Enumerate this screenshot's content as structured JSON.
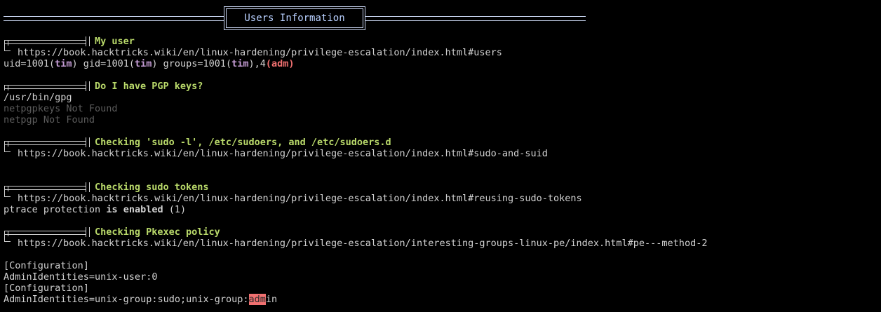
{
  "banner": {
    "title": "Users Information"
  },
  "sections": {
    "my_user": {
      "title": "My user",
      "url": "https://book.hacktricks.wiki/en/linux-hardening/privilege-escalation/index.html#users",
      "output": {
        "p1": "uid=1001(",
        "u1": "tim",
        "p2": ") gid=1001(",
        "u2": "tim",
        "p3": ") groups=1001(",
        "u3": "tim",
        "p4": "),4",
        "adm": "(adm)"
      }
    },
    "pgp": {
      "title": "Do I have PGP keys?",
      "lines": [
        "/usr/bin/gpg",
        "netpgpkeys Not Found",
        "netpgp Not Found"
      ]
    },
    "sudo_l": {
      "title": "Checking 'sudo -l', /etc/sudoers, and /etc/sudoers.d",
      "url": "https://book.hacktricks.wiki/en/linux-hardening/privilege-escalation/index.html#sudo-and-suid"
    },
    "sudo_tokens": {
      "title": "Checking sudo tokens",
      "url": "https://book.hacktricks.wiki/en/linux-hardening/privilege-escalation/index.html#reusing-sudo-tokens",
      "ptrace_a": "ptrace protection ",
      "ptrace_b": "is enabled",
      "ptrace_c": " (1)"
    },
    "pkexec": {
      "title": "Checking Pkexec policy",
      "url": "https://book.hacktricks.wiki/en/linux-hardening/privilege-escalation/interesting-groups-linux-pe/index.html#pe---method-2",
      "config1": "[Configuration]",
      "ids1": "AdminIdentities=unix-user:0",
      "config2": "[Configuration]",
      "ids2_a": "AdminIdentities=unix-group:sudo;unix-group:",
      "ids2_hl": "adm",
      "ids2_b": "in"
    }
  }
}
